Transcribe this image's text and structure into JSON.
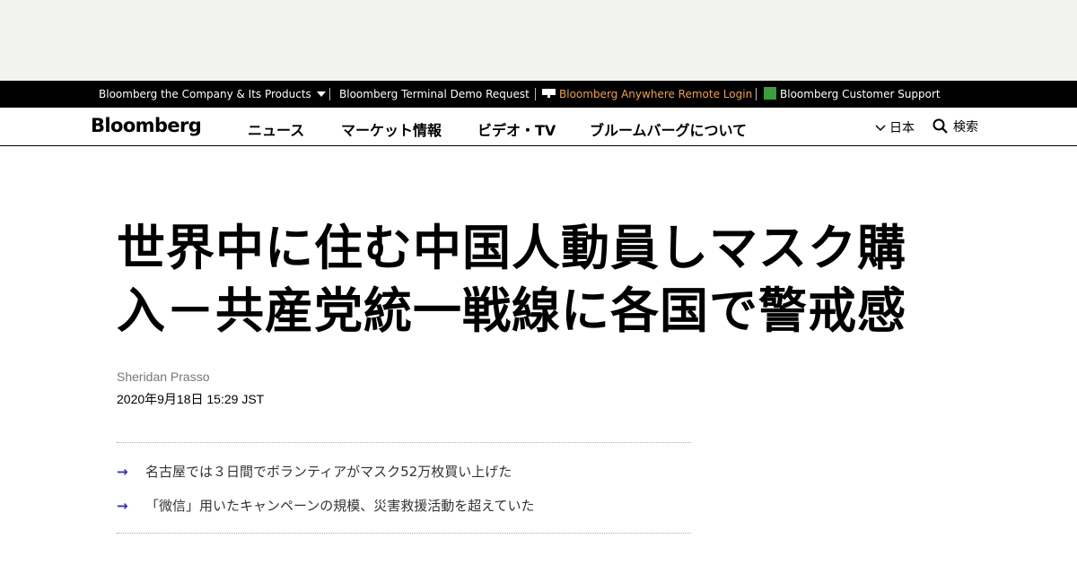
{
  "topbar": {
    "company_products": "Bloomberg the Company & Its Products",
    "terminal_demo": "Bloomberg Terminal Demo Request",
    "anywhere_login": "Bloomberg Anywhere Remote Login",
    "customer_support": "Bloomberg Customer Support",
    "help_icon_text": "Help"
  },
  "nav": {
    "logo": "Bloomberg",
    "items": [
      "ニュース",
      "マーケット情報",
      "ビデオ・TV",
      "ブルームバーグについて"
    ],
    "region": "日本",
    "search": "検索"
  },
  "article": {
    "headline_line1": "世界中に住む中国人動員しマスク購",
    "headline_line2": "入－共産党統一戦線に各国で警戒感",
    "author": "Sheridan Prasso",
    "date": "2020年9月18日 15:29 JST",
    "bullets": [
      "名古屋では３日間でボランティアがマスク52万枚買い上げた",
      "「微信」用いたキャンペーンの規模、災害救援活動を超えていた"
    ],
    "bullet_arrow": "→"
  },
  "colors": {
    "accent_orange": "#f5a13a",
    "bullet_arrow": "#2a2ad1",
    "ad_band": "#f2f2ef",
    "help_green": "#3aa03a"
  },
  "icons": [
    "chevron-down-icon",
    "terminal-icon",
    "help-icon",
    "search-icon",
    "arrow-right-icon"
  ]
}
